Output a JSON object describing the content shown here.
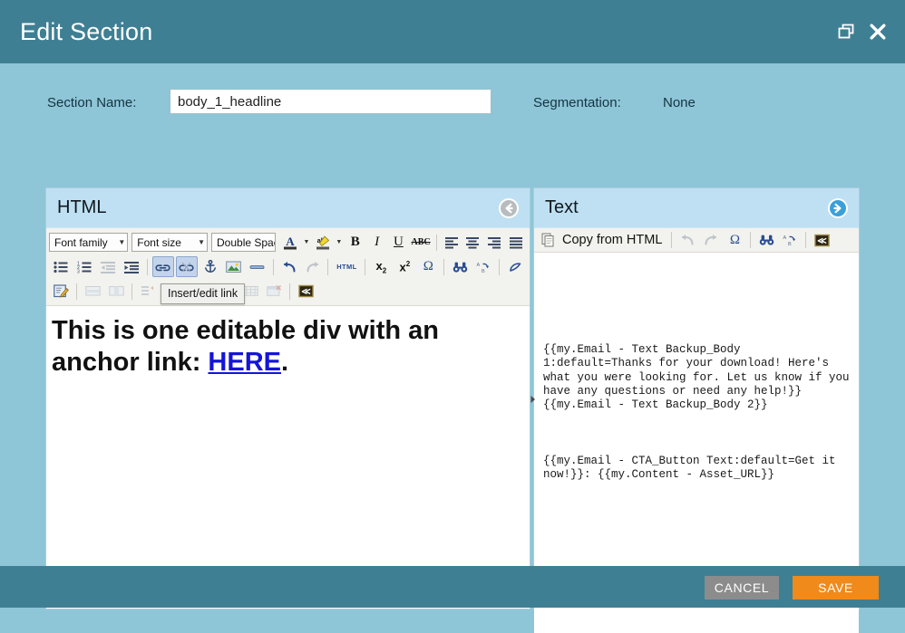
{
  "window": {
    "title": "Edit Section",
    "restore_icon": "restore-window-icon",
    "close_icon": "close-icon"
  },
  "form": {
    "section_name_label": "Section Name:",
    "section_name_value": "body_1_headline",
    "section_name_placeholder": "",
    "segmentation_label": "Segmentation:",
    "segmentation_value": "None"
  },
  "html_panel": {
    "title": "HTML",
    "collapse_icon": "arrow-left-circle-icon",
    "toolbar": {
      "row1": {
        "font_family": "Font family",
        "font_size": "Font size",
        "line_spacing": "Double Space",
        "buttons": [
          {
            "name": "text-color-button",
            "label": "A"
          },
          {
            "name": "text-color-dropdown",
            "label": "▾"
          },
          {
            "name": "background-color-button",
            "label": "ab"
          },
          {
            "name": "background-color-dropdown",
            "label": "▾"
          },
          {
            "name": "bold-button",
            "label": "B"
          },
          {
            "name": "italic-button",
            "label": "I"
          },
          {
            "name": "underline-button",
            "label": "U"
          },
          {
            "name": "strikethrough-button",
            "label": "ABC"
          },
          {
            "name": "align-left-button",
            "label": "align-left-icon"
          },
          {
            "name": "align-center-button",
            "label": "align-center-icon"
          },
          {
            "name": "align-right-button",
            "label": "align-right-icon"
          },
          {
            "name": "align-justify-button",
            "label": "align-justify-icon"
          }
        ]
      },
      "row2": {
        "buttons": [
          {
            "name": "bullet-list-button",
            "label": "unordered-list-icon"
          },
          {
            "name": "numbered-list-button",
            "label": "ordered-list-icon"
          },
          {
            "name": "outdent-button",
            "label": "outdent-icon"
          },
          {
            "name": "indent-button",
            "label": "indent-icon"
          },
          {
            "name": "insert-link-button",
            "label": "link-icon"
          },
          {
            "name": "unlink-button",
            "label": "unlink-icon"
          },
          {
            "name": "anchor-button",
            "label": "anchor-icon"
          },
          {
            "name": "insert-image-button",
            "label": "image-icon"
          },
          {
            "name": "horizontal-rule-button",
            "label": "horizontal-rule-icon"
          },
          {
            "name": "undo-button",
            "label": "undo-icon"
          },
          {
            "name": "redo-button",
            "label": "redo-icon"
          },
          {
            "name": "edit-html-source-button",
            "label": "HTML"
          },
          {
            "name": "subscript-button",
            "label": "x₂"
          },
          {
            "name": "superscript-button",
            "label": "x²"
          },
          {
            "name": "special-character-button",
            "label": "Ω"
          },
          {
            "name": "find-button",
            "label": "binoculars-icon"
          },
          {
            "name": "find-replace-button",
            "label": "find-replace-icon"
          },
          {
            "name": "remove-formatting-button",
            "label": "eraser-icon"
          }
        ]
      },
      "row3": {
        "buttons": [
          {
            "name": "edit-personalization-button",
            "label": "edit-note-icon"
          },
          {
            "name": "table-row-properties-button",
            "label": "table-row-icon"
          },
          {
            "name": "table-cell-properties-button",
            "label": "table-cell-icon"
          },
          {
            "name": "insert-row-before-button",
            "label": "insert-row-before-icon"
          },
          {
            "name": "insert-row-after-button",
            "label": "insert-row-after-icon"
          },
          {
            "name": "delete-row-button",
            "label": "delete-row-icon"
          },
          {
            "name": "split-merge-cells-button",
            "label": "merge-cells-icon"
          },
          {
            "name": "insert-table-button",
            "label": "insert-table-icon"
          },
          {
            "name": "table-properties-button",
            "label": "table-properties-icon"
          },
          {
            "name": "delete-table-button",
            "label": "delete-table-icon"
          },
          {
            "name": "insert-token-button",
            "label": "token-icon"
          }
        ]
      },
      "tooltip": "Insert/edit link"
    },
    "content": {
      "line1": "This is one editable div with an",
      "line2_prefix": "anchor link: ",
      "link_text": "HERE",
      "line2_suffix": "."
    }
  },
  "text_panel": {
    "title": "Text",
    "expand_icon": "arrow-right-circle-icon",
    "toolbar": {
      "copy_from_html_label": "Copy from HTML",
      "copy_icon": "copy-icon",
      "buttons": [
        {
          "name": "undo-button",
          "label": "undo-icon"
        },
        {
          "name": "redo-button",
          "label": "redo-icon"
        },
        {
          "name": "special-character-button",
          "label": "Ω"
        },
        {
          "name": "find-button",
          "label": "binoculars-icon"
        },
        {
          "name": "find-replace-button",
          "label": "find-replace-icon"
        },
        {
          "name": "insert-token-button",
          "label": "token-icon"
        }
      ]
    },
    "content": {
      "paragraph1": "{{my.Email - Text Backup_Body 1:default=Thanks for your download! Here's what you were looking for. Let us know if you have any questions or need any help!}} {{my.Email - Text Backup_Body 2}}",
      "paragraph2": "{{my.Email - CTA_Button Text:default=Get it now!}}: {{my.Content - Asset_URL}}"
    }
  },
  "splitter": {
    "handle_icon": "splitter-arrow-icon"
  },
  "footer": {
    "cancel_label": "CANCEL",
    "save_label": "SAVE"
  },
  "colors": {
    "header_teal": "#3f7f94",
    "body_blue": "#8ec6d8",
    "panel_head_blue": "#bfe0f3",
    "save_orange": "#f08a1a",
    "cancel_gray": "#8c8c8c",
    "link_blue": "#1414d8"
  }
}
